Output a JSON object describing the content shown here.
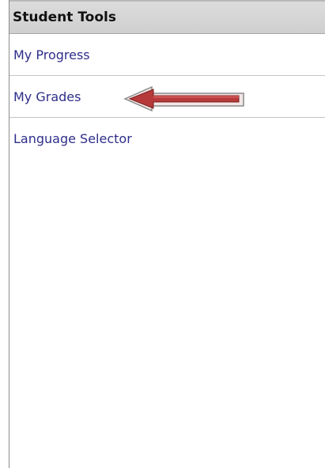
{
  "panel": {
    "title": "Student Tools",
    "items": [
      {
        "label": "My Progress"
      },
      {
        "label": "My Grades"
      },
      {
        "label": "Language Selector"
      }
    ]
  },
  "annotation": {
    "icon": "arrow-left-icon",
    "color": "#c0392b",
    "points_to": "My Grades"
  }
}
